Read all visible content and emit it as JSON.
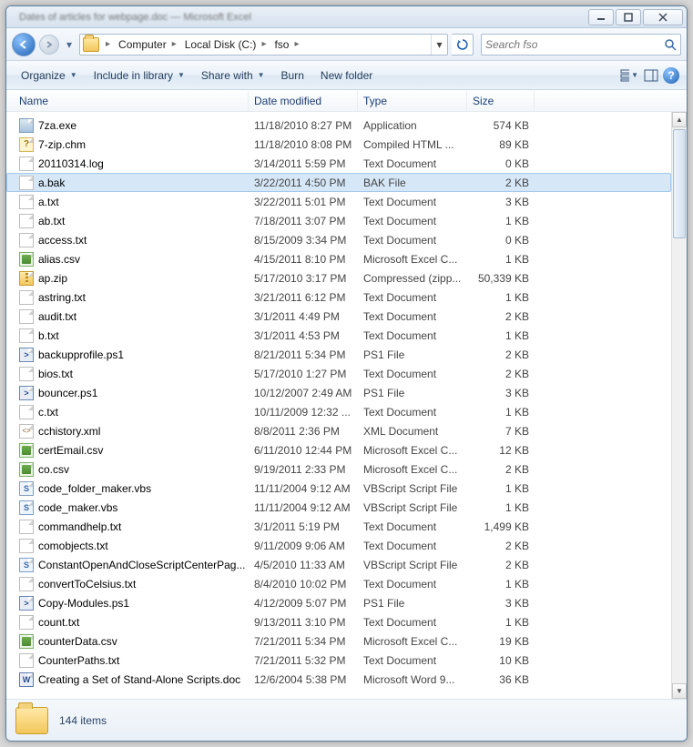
{
  "titlebar": {
    "blurred_title": "Dates of articles for webpage.doc — Microsoft Excel"
  },
  "breadcrumbs": [
    "Computer",
    "Local Disk (C:)",
    "fso"
  ],
  "search": {
    "placeholder": "Search fso"
  },
  "toolbar": {
    "organize": "Organize",
    "include": "Include in library",
    "share": "Share with",
    "burn": "Burn",
    "newfolder": "New folder"
  },
  "columns": {
    "name": "Name",
    "date": "Date modified",
    "type": "Type",
    "size": "Size"
  },
  "selected_index": 3,
  "files": [
    {
      "name": "7za.exe",
      "date": "11/18/2010 8:27 PM",
      "type": "Application",
      "size": "574 KB",
      "ico": "app"
    },
    {
      "name": "7-zip.chm",
      "date": "11/18/2010 8:08 PM",
      "type": "Compiled HTML ...",
      "size": "89 KB",
      "ico": "chm"
    },
    {
      "name": "20110314.log",
      "date": "3/14/2011 5:59 PM",
      "type": "Text Document",
      "size": "0 KB",
      "ico": "txt"
    },
    {
      "name": "a.bak",
      "date": "3/22/2011 4:50 PM",
      "type": "BAK File",
      "size": "2 KB",
      "ico": "txt"
    },
    {
      "name": "a.txt",
      "date": "3/22/2011 5:01 PM",
      "type": "Text Document",
      "size": "3 KB",
      "ico": "txt"
    },
    {
      "name": "ab.txt",
      "date": "7/18/2011 3:07 PM",
      "type": "Text Document",
      "size": "1 KB",
      "ico": "txt"
    },
    {
      "name": "access.txt",
      "date": "8/15/2009 3:34 PM",
      "type": "Text Document",
      "size": "0 KB",
      "ico": "txt"
    },
    {
      "name": "alias.csv",
      "date": "4/15/2011 8:10 PM",
      "type": "Microsoft Excel C...",
      "size": "1 KB",
      "ico": "csv"
    },
    {
      "name": "ap.zip",
      "date": "5/17/2010 3:17 PM",
      "type": "Compressed (zipp...",
      "size": "50,339 KB",
      "ico": "zip"
    },
    {
      "name": "astring.txt",
      "date": "3/21/2011 6:12 PM",
      "type": "Text Document",
      "size": "1 KB",
      "ico": "txt"
    },
    {
      "name": "audit.txt",
      "date": "3/1/2011 4:49 PM",
      "type": "Text Document",
      "size": "2 KB",
      "ico": "txt"
    },
    {
      "name": "b.txt",
      "date": "3/1/2011 4:53 PM",
      "type": "Text Document",
      "size": "1 KB",
      "ico": "txt"
    },
    {
      "name": "backupprofile.ps1",
      "date": "8/21/2011 5:34 PM",
      "type": "PS1 File",
      "size": "2 KB",
      "ico": "ps1"
    },
    {
      "name": "bios.txt",
      "date": "5/17/2010 1:27 PM",
      "type": "Text Document",
      "size": "2 KB",
      "ico": "txt"
    },
    {
      "name": "bouncer.ps1",
      "date": "10/12/2007 2:49 AM",
      "type": "PS1 File",
      "size": "3 KB",
      "ico": "ps1"
    },
    {
      "name": "c.txt",
      "date": "10/11/2009 12:32 ...",
      "type": "Text Document",
      "size": "1 KB",
      "ico": "txt"
    },
    {
      "name": "cchistory.xml",
      "date": "8/8/2011 2:36 PM",
      "type": "XML Document",
      "size": "7 KB",
      "ico": "xml"
    },
    {
      "name": "certEmail.csv",
      "date": "6/11/2010 12:44 PM",
      "type": "Microsoft Excel C...",
      "size": "12 KB",
      "ico": "csv"
    },
    {
      "name": "co.csv",
      "date": "9/19/2011 2:33 PM",
      "type": "Microsoft Excel C...",
      "size": "2 KB",
      "ico": "csv"
    },
    {
      "name": "code_folder_maker.vbs",
      "date": "11/11/2004 9:12 AM",
      "type": "VBScript Script File",
      "size": "1 KB",
      "ico": "vbs"
    },
    {
      "name": "code_maker.vbs",
      "date": "11/11/2004 9:12 AM",
      "type": "VBScript Script File",
      "size": "1 KB",
      "ico": "vbs"
    },
    {
      "name": "commandhelp.txt",
      "date": "3/1/2011 5:19 PM",
      "type": "Text Document",
      "size": "1,499 KB",
      "ico": "txt"
    },
    {
      "name": "comobjects.txt",
      "date": "9/11/2009 9:06 AM",
      "type": "Text Document",
      "size": "2 KB",
      "ico": "txt"
    },
    {
      "name": "ConstantOpenAndCloseScriptCenterPag...",
      "date": "4/5/2010 11:33 AM",
      "type": "VBScript Script File",
      "size": "2 KB",
      "ico": "vbs"
    },
    {
      "name": "convertToCelsius.txt",
      "date": "8/4/2010 10:02 PM",
      "type": "Text Document",
      "size": "1 KB",
      "ico": "txt"
    },
    {
      "name": "Copy-Modules.ps1",
      "date": "4/12/2009 5:07 PM",
      "type": "PS1 File",
      "size": "3 KB",
      "ico": "ps1"
    },
    {
      "name": "count.txt",
      "date": "9/13/2011 3:10 PM",
      "type": "Text Document",
      "size": "1 KB",
      "ico": "txt"
    },
    {
      "name": "counterData.csv",
      "date": "7/21/2011 5:34 PM",
      "type": "Microsoft Excel C...",
      "size": "19 KB",
      "ico": "csv"
    },
    {
      "name": "CounterPaths.txt",
      "date": "7/21/2011 5:32 PM",
      "type": "Text Document",
      "size": "10 KB",
      "ico": "txt"
    },
    {
      "name": "Creating a Set of Stand-Alone Scripts.doc",
      "date": "12/6/2004 5:38 PM",
      "type": "Microsoft Word 9...",
      "size": "36 KB",
      "ico": "doc"
    }
  ],
  "status": {
    "count_label": "144 items"
  }
}
